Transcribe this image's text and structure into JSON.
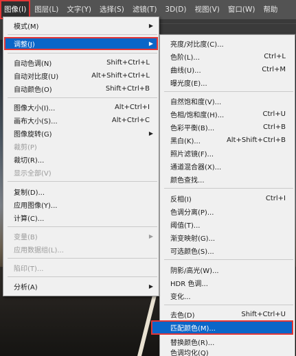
{
  "menubar": {
    "items": [
      {
        "label": "图像(I)"
      },
      {
        "label": "图层(L)"
      },
      {
        "label": "文字(Y)"
      },
      {
        "label": "选择(S)"
      },
      {
        "label": "滤镜(T)"
      },
      {
        "label": "3D(D)"
      },
      {
        "label": "视图(V)"
      },
      {
        "label": "窗口(W)"
      },
      {
        "label": "帮助"
      }
    ]
  },
  "image_menu": {
    "items": [
      {
        "label": "模式(M)"
      },
      {
        "label": "调整(J)"
      },
      {
        "label": "自动色调(N)",
        "shortcut": "Shift+Ctrl+L"
      },
      {
        "label": "自动对比度(U)",
        "shortcut": "Alt+Shift+Ctrl+L"
      },
      {
        "label": "自动颜色(O)",
        "shortcut": "Shift+Ctrl+B"
      },
      {
        "label": "图像大小(I)...",
        "shortcut": "Alt+Ctrl+I"
      },
      {
        "label": "画布大小(S)...",
        "shortcut": "Alt+Ctrl+C"
      },
      {
        "label": "图像旋转(G)"
      },
      {
        "label": "裁剪(P)"
      },
      {
        "label": "裁切(R)..."
      },
      {
        "label": "显示全部(V)"
      },
      {
        "label": "复制(D)..."
      },
      {
        "label": "应用图像(Y)..."
      },
      {
        "label": "计算(C)..."
      },
      {
        "label": "变量(B)"
      },
      {
        "label": "应用数据组(L)..."
      },
      {
        "label": "陷印(T)..."
      },
      {
        "label": "分析(A)"
      }
    ]
  },
  "adjust_menu": {
    "items": [
      {
        "label": "亮度/对比度(C)..."
      },
      {
        "label": "色阶(L)...",
        "shortcut": "Ctrl+L"
      },
      {
        "label": "曲线(U)...",
        "shortcut": "Ctrl+M"
      },
      {
        "label": "曝光度(E)..."
      },
      {
        "label": "自然饱和度(V)..."
      },
      {
        "label": "色相/饱和度(H)...",
        "shortcut": "Ctrl+U"
      },
      {
        "label": "色彩平衡(B)...",
        "shortcut": "Ctrl+B"
      },
      {
        "label": "黑白(K)...",
        "shortcut": "Alt+Shift+Ctrl+B"
      },
      {
        "label": "照片滤镜(F)..."
      },
      {
        "label": "通道混合器(X)..."
      },
      {
        "label": "颜色查找..."
      },
      {
        "label": "反相(I)",
        "shortcut": "Ctrl+I"
      },
      {
        "label": "色调分离(P)..."
      },
      {
        "label": "阈值(T)..."
      },
      {
        "label": "渐变映射(G)..."
      },
      {
        "label": "可选颜色(S)..."
      },
      {
        "label": "阴影/高光(W)..."
      },
      {
        "label": "HDR 色调..."
      },
      {
        "label": "变化..."
      },
      {
        "label": "去色(D)",
        "shortcut": "Shift+Ctrl+U"
      },
      {
        "label": "匹配颜色(M)..."
      },
      {
        "label": "替换颜色(R)..."
      },
      {
        "label": "色调均化(Q)"
      }
    ]
  },
  "colors": {
    "highlight": "#0a66c8",
    "annotation_box": "#e23636",
    "menu_bg": "#f0f0f0",
    "menubar_bg": "#535353"
  }
}
